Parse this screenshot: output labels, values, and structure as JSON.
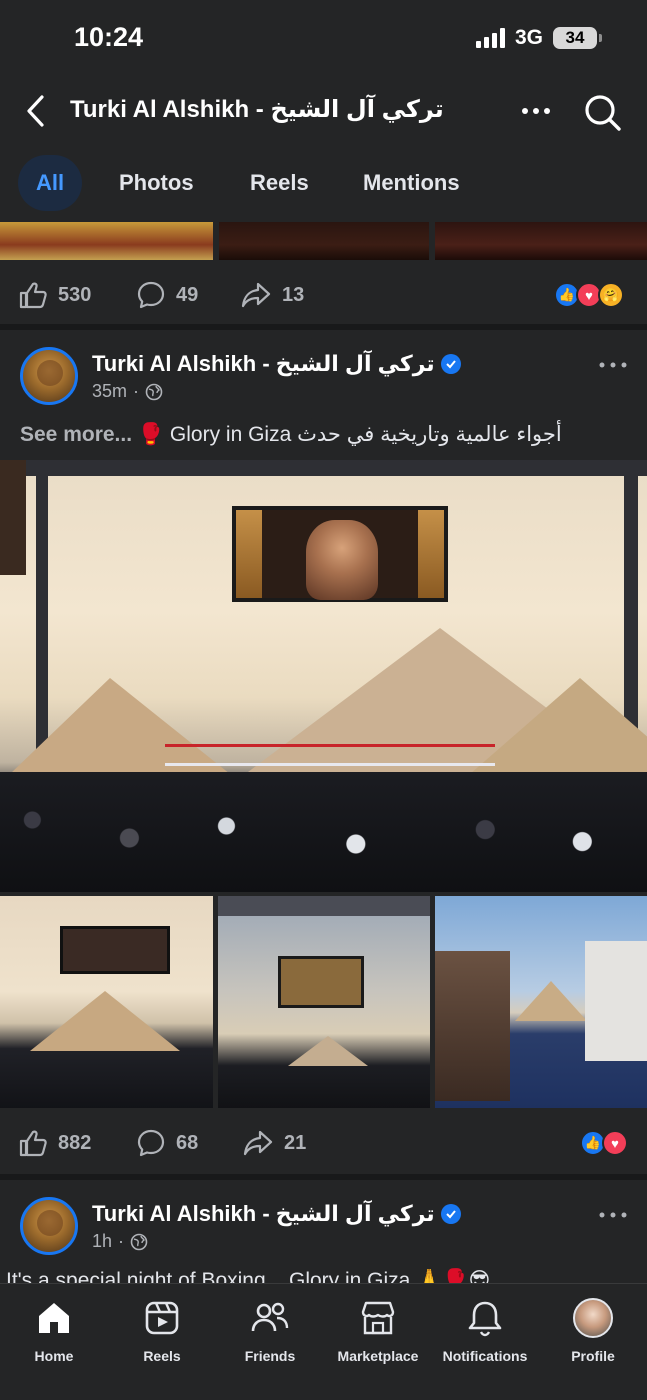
{
  "status_bar": {
    "time": "10:24",
    "network": "3G",
    "battery": "34"
  },
  "header": {
    "title": "Turki Al Alshikh - تركي آل الشيخ"
  },
  "tabs": [
    {
      "label": "All",
      "active": true
    },
    {
      "label": "Photos",
      "active": false
    },
    {
      "label": "Reels",
      "active": false
    },
    {
      "label": "Mentions",
      "active": false
    }
  ],
  "post1_actions": {
    "likes": "530",
    "comments": "49",
    "shares": "13"
  },
  "post2": {
    "author": "Turki Al Alshikh - تركي آل الشيخ",
    "time": "35m",
    "see_more": "See more...",
    "caption": "أجواء عالمية وتاريخية في حدث Glory in Giza 🥊",
    "likes": "882",
    "comments": "68",
    "shares": "21"
  },
  "post3": {
    "author": "Turki Al Alshikh - تركي آل الشيخ",
    "time": "1h",
    "caption": "It's a special night of Boxing... Glory in Giza 🙏🥊😎"
  },
  "tab_bar": [
    {
      "label": "Home",
      "icon": "home-icon"
    },
    {
      "label": "Reels",
      "icon": "reels-icon"
    },
    {
      "label": "Friends",
      "icon": "friends-icon"
    },
    {
      "label": "Marketplace",
      "icon": "marketplace-icon"
    },
    {
      "label": "Notifications",
      "icon": "bell-icon"
    },
    {
      "label": "Profile",
      "icon": "profile-avatar"
    }
  ],
  "colors": {
    "background": "#242526",
    "accent": "#4599ff",
    "like_blue": "#1877f2",
    "love_red": "#f33e58"
  }
}
